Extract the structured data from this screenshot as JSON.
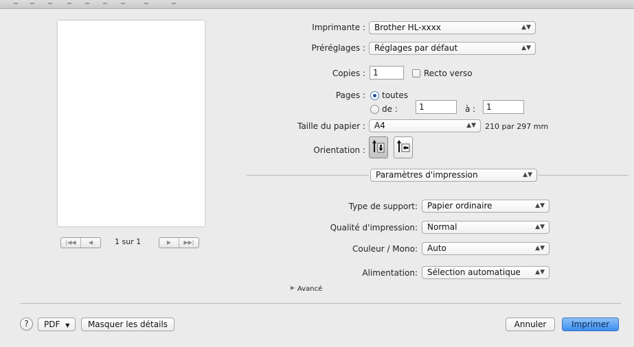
{
  "printer": {
    "label": "Imprimante :",
    "value": "Brother HL-xxxx"
  },
  "presets": {
    "label": "Préréglages :",
    "value": "Réglages par défaut"
  },
  "copies": {
    "label": "Copies :",
    "value": "1",
    "duplex_label": "Recto verso"
  },
  "pages": {
    "label": "Pages :",
    "all_label": "toutes",
    "range_from_label": "de :",
    "range_from_value": "1",
    "range_to_label": "à :",
    "range_to_value": "1"
  },
  "paper": {
    "label": "Taille du papier :",
    "value": "A4",
    "dimensions": "210 par 297 mm"
  },
  "orientation": {
    "label": "Orientation :"
  },
  "panel_select": {
    "value": "Paramètres d'impression"
  },
  "media_type": {
    "label": "Type de support:",
    "value": "Papier ordinaire"
  },
  "quality": {
    "label": "Qualité d'impression:",
    "value": "Normal"
  },
  "color_mode": {
    "label": "Couleur / Mono:",
    "value": "Auto"
  },
  "paper_source": {
    "label": "Alimentation:",
    "value": "Sélection automatique"
  },
  "advanced": {
    "label": "Avancé"
  },
  "preview": {
    "page_counter": "1 sur 1"
  },
  "footer": {
    "help": "?",
    "pdf_label": "PDF",
    "hide_details_label": "Masquer les détails",
    "cancel_label": "Annuler",
    "print_label": "Imprimer"
  },
  "colors": {
    "accent": "#3b8ef2",
    "background": "#ebebeb"
  }
}
